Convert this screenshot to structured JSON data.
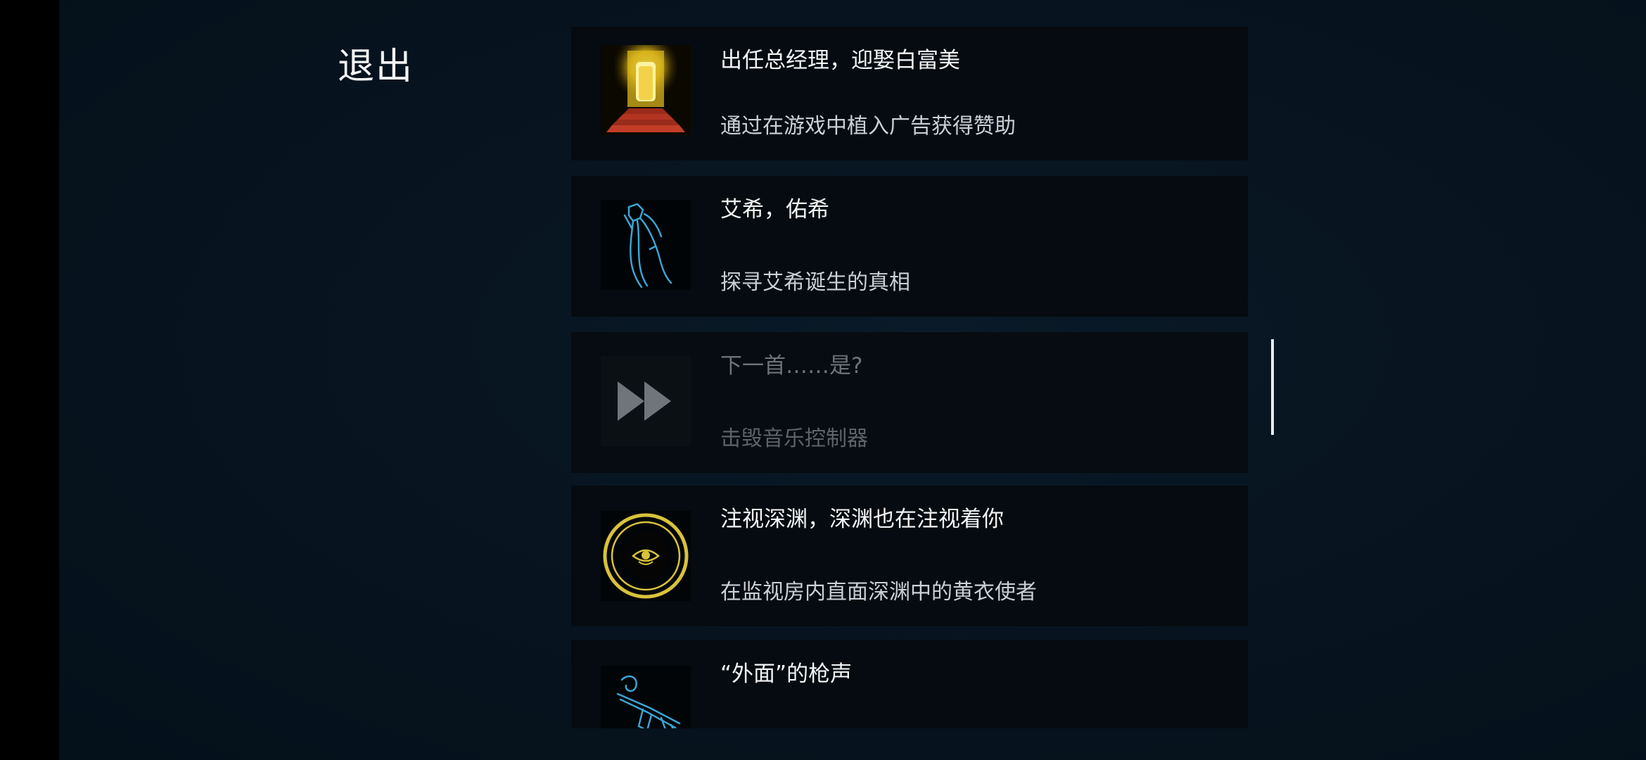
{
  "header": {
    "exit_label": "退出"
  },
  "achievements": [
    {
      "title": "出任总经理，迎娶白富美",
      "description": "通过在游戏中植入广告获得赞助",
      "icon": "golden-stairway-icon",
      "locked": false
    },
    {
      "title": "艾希，佑希",
      "description": "探寻艾希诞生的真相",
      "icon": "blue-scythe-icon",
      "locked": false
    },
    {
      "title": "下一首……是?",
      "description": "击毁音乐控制器",
      "icon": "fast-forward-icon",
      "locked": true
    },
    {
      "title": "注视深渊，深渊也在注视着你",
      "description": "在监视房内直面深渊中的黄衣使者",
      "icon": "eye-circle-icon",
      "locked": false
    },
    {
      "title": "“外面”的枪声",
      "description": "",
      "icon": "blue-gun-icon",
      "locked": false
    }
  ],
  "colors": {
    "background": "#07131e",
    "card": "#050b10",
    "gold": "#d8c23a",
    "cyan": "#3aa8d8",
    "locked_text": "#6e7378"
  }
}
